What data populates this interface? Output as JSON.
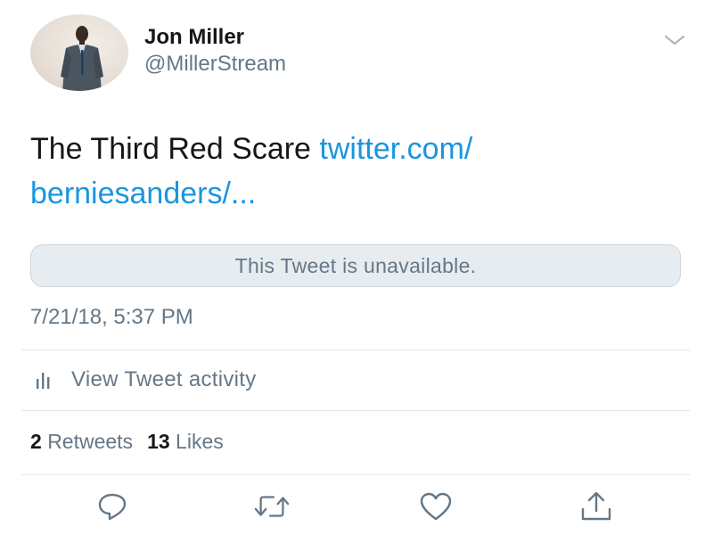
{
  "author": {
    "name": "Jon Miller",
    "handle": "@MillerStream"
  },
  "tweet": {
    "text": "The Third Red Scare ",
    "link_text": "twitter.com/\nberniesanders/...",
    "quoted_notice": "This Tweet is unavailable.",
    "timestamp": "7/21/18, 5:37 PM"
  },
  "activity": {
    "icon": "bar-chart-icon",
    "label": "View Tweet activity"
  },
  "stats": {
    "retweets_count": "2",
    "retweets_label": "Retweets",
    "likes_count": "13",
    "likes_label": "Likes"
  },
  "actions": [
    {
      "icon": "reply-icon"
    },
    {
      "icon": "retweet-icon"
    },
    {
      "icon": "like-icon"
    },
    {
      "icon": "share-icon"
    }
  ],
  "colors": {
    "link": "#1b95e0",
    "secondary_text": "#657786",
    "primary_text": "#14171a",
    "divider": "#e1e8ed",
    "notice_bg": "#e6ecf0"
  }
}
